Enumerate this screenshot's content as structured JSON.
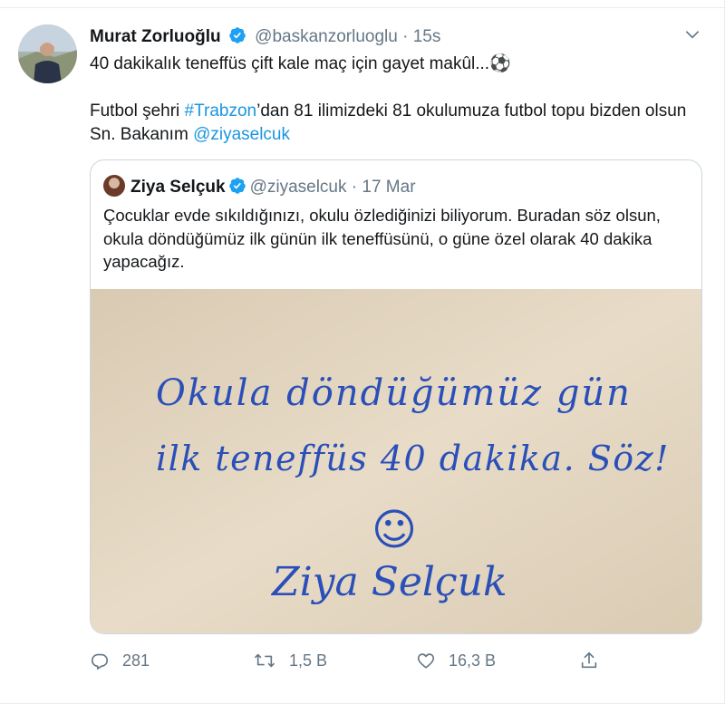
{
  "tweet": {
    "author_name": "Murat Zorluoğlu",
    "handle": "@baskanzorluoglu",
    "separator": "·",
    "time": "15s",
    "line1": "40 dakikalık teneffüs çift kale maç için gayet makûl...⚽",
    "line2_before": "Futbol şehri ",
    "hashtag": "#Trabzon",
    "line2_after": "’dan 81 ilimizdeki 81 okulumuza futbol topu bizden olsun Sn. Bakanım ",
    "mention": "@ziyaselcuk"
  },
  "quoted": {
    "author_name": "Ziya Selçuk",
    "handle": "@ziyaselcuk",
    "separator": "·",
    "date": "17 Mar",
    "text": "Çocuklar evde sıkıldığınızı, okulu özlediğinizi biliyorum. Buradan söz olsun, okula döndüğümüz ilk günün ilk teneffüsünü, o güne özel olarak 40 dakika yapacağız.",
    "handwriting_line1": "Okula döndüğümüz gün",
    "handwriting_line2": "ilk teneffüs 40 dakika. Söz!",
    "smiley": "☺",
    "signature": "Ziya Selçuk"
  },
  "actions": {
    "replies": "281",
    "retweets": "1,5 B",
    "likes": "16,3 B"
  },
  "colors": {
    "link": "#1b95e0",
    "verified": "#1da1f2",
    "muted": "#657786",
    "ink": "#2a4fb8",
    "paper": "#e6d9c4"
  },
  "icons": [
    "verified-badge-icon",
    "chevron-down-icon",
    "reply-icon",
    "retweet-icon",
    "like-icon",
    "share-icon"
  ]
}
